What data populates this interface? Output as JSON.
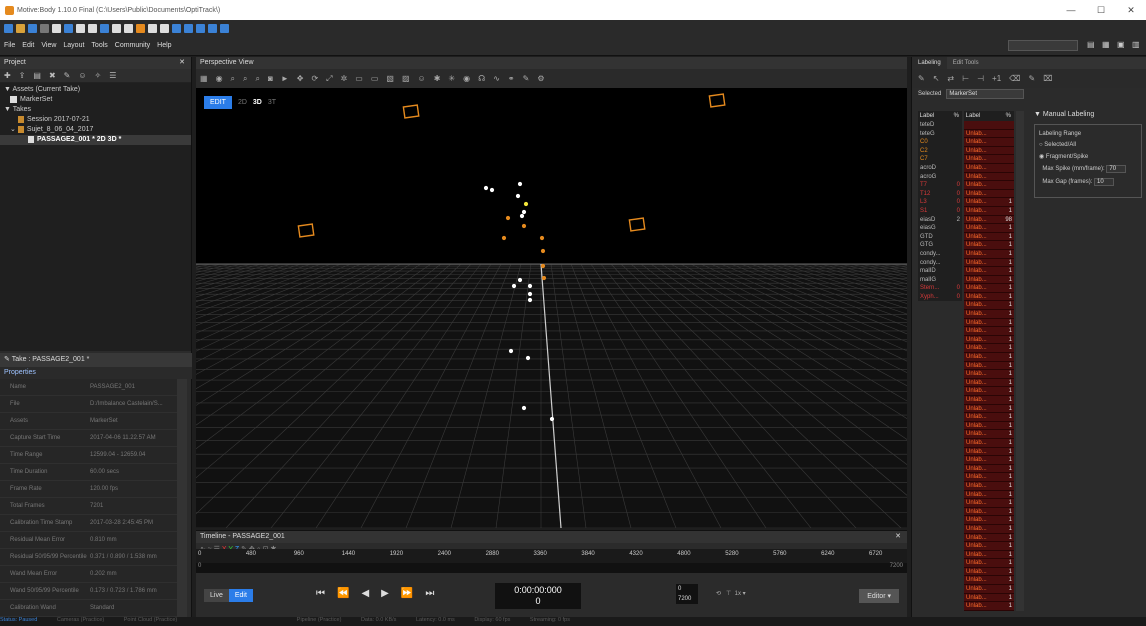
{
  "window": {
    "title": "Motive:Body 1.10.0 Final (C:\\Users\\Public\\Documents\\OptiTrack\\)"
  },
  "menu": [
    "File",
    "Edit",
    "View",
    "Layout",
    "Tools",
    "Community",
    "Help"
  ],
  "project": {
    "header": "Project",
    "tree": [
      {
        "label": "Assets (Current Take)",
        "indent": 0
      },
      {
        "label": "MarkerSet",
        "indent": 1
      },
      {
        "label": "Takes",
        "indent": 0
      },
      {
        "label": "Session 2017-07-21",
        "indent": 1
      },
      {
        "label": "Sujet_8_06_04_2017",
        "indent": 1
      },
      {
        "label": "PASSAGE2_001 *   2D   3D *",
        "indent": 2
      }
    ],
    "take_header": "Take : PASSAGE2_001 *",
    "props_tab": "Properties",
    "properties": [
      {
        "k": "Name",
        "v": "PASSAGE2_001"
      },
      {
        "k": "File",
        "v": "D:/Imbalance Castelain/S..."
      },
      {
        "k": "Assets",
        "v": "MarkerSet"
      },
      {
        "k": "Capture Start Time",
        "v": "2017-04-06 11.22.57 AM"
      },
      {
        "k": "Time Range",
        "v": "12599.04 - 12659.04"
      },
      {
        "k": "Time Duration",
        "v": "60.00 secs"
      },
      {
        "k": "Frame Rate",
        "v": "120.00 fps"
      },
      {
        "k": "Total Frames",
        "v": "7201"
      },
      {
        "k": "Calibration Time Stamp",
        "v": "2017-03-28 2:45:45 PM"
      },
      {
        "k": "Residual Mean Error",
        "v": "0.810 mm"
      },
      {
        "k": "Residual 50/95/99 Percentile",
        "v": "0.371 / 0.890 / 1.538 mm"
      },
      {
        "k": "Wand Mean Error",
        "v": "0.202 mm"
      },
      {
        "k": "Wand 50/95/99 Percentile",
        "v": "0.173 / 0.723 / 1.786 mm"
      },
      {
        "k": "Calibration Wand",
        "v": "Standard"
      },
      {
        "k": "Wand Length",
        "v": "500 mm"
      }
    ]
  },
  "perspective": {
    "header": "Perspective View",
    "modes": {
      "edit": "EDIT",
      "m2d": "2D",
      "m3d": "3D",
      "m3": "3T"
    }
  },
  "timeline": {
    "header": "Timeline - PASSAGE2_001",
    "ticks": [
      "0",
      "480",
      "960",
      "1440",
      "1920",
      "2400",
      "2880",
      "3360",
      "3840",
      "4320",
      "4800",
      "5280",
      "5760",
      "6240",
      "6720"
    ],
    "track_start": "0",
    "track_end": "7200",
    "live": "Live",
    "edit": "Edit",
    "timecode": "0:00:00:000",
    "frame": "0",
    "range_start": "0",
    "range_end": "7200",
    "speed": "1x",
    "editor": "Editor"
  },
  "labeling": {
    "tabs": [
      "Labeling",
      "Edit Tools"
    ],
    "selected_label": "Selected",
    "selected_value": "MarkerSet",
    "col_label": "Label",
    "col_pct": "%",
    "names": [
      {
        "n": "teteD",
        "p": "",
        "c": "#bbbbbb"
      },
      {
        "n": "teteG",
        "p": "",
        "c": "#bbbbbb"
      },
      {
        "n": "C0",
        "p": "",
        "c": "#e58a1e"
      },
      {
        "n": "C2",
        "p": "",
        "c": "#e58a1e"
      },
      {
        "n": "C7",
        "p": "",
        "c": "#e58a1e"
      },
      {
        "n": "acroD",
        "p": "",
        "c": "#bbbbbb"
      },
      {
        "n": "acroG",
        "p": "",
        "c": "#bbbbbb"
      },
      {
        "n": "T7",
        "p": "0",
        "c": "#d83a3a"
      },
      {
        "n": "T12",
        "p": "0",
        "c": "#d83a3a"
      },
      {
        "n": "L3",
        "p": "0",
        "c": "#d83a3a"
      },
      {
        "n": "S1",
        "p": "0",
        "c": "#d83a3a"
      },
      {
        "n": "eiasD",
        "p": "2",
        "c": "#bbbbbb"
      },
      {
        "n": "eiasG",
        "p": "",
        "c": "#bbbbbb"
      },
      {
        "n": "GTD",
        "p": "",
        "c": "#bbbbbb"
      },
      {
        "n": "GTG",
        "p": "",
        "c": "#bbbbbb"
      },
      {
        "n": "condy...",
        "p": "",
        "c": "#bbbbbb"
      },
      {
        "n": "condy...",
        "p": "",
        "c": "#bbbbbb"
      },
      {
        "n": "malID",
        "p": "",
        "c": "#bbbbbb"
      },
      {
        "n": "malIG",
        "p": "",
        "c": "#bbbbbb"
      },
      {
        "n": "Stern...",
        "p": "0",
        "c": "#d83a3a"
      },
      {
        "n": "Xyph...",
        "p": "0",
        "c": "#d83a3a"
      }
    ],
    "unlab_rows": [
      {
        "t": "",
        "p": ""
      },
      {
        "t": "Unlab...",
        "p": ""
      },
      {
        "t": "Unlab...",
        "p": ""
      },
      {
        "t": "Unlab...",
        "p": ""
      },
      {
        "t": "Unlab...",
        "p": ""
      },
      {
        "t": "Unlab...",
        "p": ""
      },
      {
        "t": "Unlab...",
        "p": ""
      },
      {
        "t": "Unlab...",
        "p": ""
      },
      {
        "t": "Unlab...",
        "p": ""
      },
      {
        "t": "Unlab...",
        "p": "1"
      },
      {
        "t": "Unlab...",
        "p": "1"
      },
      {
        "t": "Unlab...",
        "p": "98"
      },
      {
        "t": "Unlab...",
        "p": "1"
      },
      {
        "t": "Unlab...",
        "p": "1"
      },
      {
        "t": "Unlab...",
        "p": "1"
      },
      {
        "t": "Unlab...",
        "p": "1"
      },
      {
        "t": "Unlab...",
        "p": "1"
      },
      {
        "t": "Unlab...",
        "p": "1"
      },
      {
        "t": "Unlab...",
        "p": "1"
      },
      {
        "t": "Unlab...",
        "p": "1"
      },
      {
        "t": "Unlab...",
        "p": "1"
      },
      {
        "t": "Unlab...",
        "p": "1"
      },
      {
        "t": "Unlab...",
        "p": "1"
      },
      {
        "t": "Unlab...",
        "p": "1"
      },
      {
        "t": "Unlab...",
        "p": "1"
      },
      {
        "t": "Unlab...",
        "p": "1"
      },
      {
        "t": "Unlab...",
        "p": "1"
      },
      {
        "t": "Unlab...",
        "p": "1"
      },
      {
        "t": "Unlab...",
        "p": "1"
      },
      {
        "t": "Unlab...",
        "p": "1"
      },
      {
        "t": "Unlab...",
        "p": "1"
      },
      {
        "t": "Unlab...",
        "p": "1"
      },
      {
        "t": "Unlab...",
        "p": "1"
      },
      {
        "t": "Unlab...",
        "p": "1"
      },
      {
        "t": "Unlab...",
        "p": "1"
      },
      {
        "t": "Unlab...",
        "p": "1"
      },
      {
        "t": "Unlab...",
        "p": "1"
      },
      {
        "t": "Unlab...",
        "p": "1"
      },
      {
        "t": "Unlab...",
        "p": "1"
      },
      {
        "t": "Unlab...",
        "p": "1"
      },
      {
        "t": "Unlab...",
        "p": "1"
      },
      {
        "t": "Unlab...",
        "p": "1"
      },
      {
        "t": "Unlab...",
        "p": "1"
      },
      {
        "t": "Unlab...",
        "p": "1"
      },
      {
        "t": "Unlab...",
        "p": "1"
      },
      {
        "t": "Unlab...",
        "p": "1"
      },
      {
        "t": "Unlab...",
        "p": "1"
      },
      {
        "t": "Unlab...",
        "p": "1"
      },
      {
        "t": "Unlab...",
        "p": "1"
      },
      {
        "t": "Unlab...",
        "p": "1"
      },
      {
        "t": "Unlab...",
        "p": "1"
      },
      {
        "t": "Unlab...",
        "p": "1"
      },
      {
        "t": "Unlab...",
        "p": "1"
      },
      {
        "t": "Unlab...",
        "p": "1"
      },
      {
        "t": "Unlab...",
        "p": "1"
      },
      {
        "t": "Unlab...",
        "p": "1"
      },
      {
        "t": "Unlab...",
        "p": "1"
      }
    ],
    "manual": {
      "title": "Manual Labeling",
      "range_title": "Labeling Range",
      "opt1": "Selected/All",
      "opt2": "Fragment/Spike",
      "spike_label": "Max Spike (mm/frame):",
      "spike_value": "70",
      "gap_label": "Max Gap (frames):",
      "gap_value": "10"
    }
  },
  "status": [
    "Status: Paused",
    "Cameras (Practice)",
    "Point Cloud (Practice)",
    "Pipeline (Practice)",
    "Data: 0.0 KB/s",
    "Latency: 0.0 ms",
    "Display: 60 fps",
    "Streaming: 0 fps"
  ],
  "colors": {
    "accent": "#2b7de9",
    "marker_orange": "#e58a1e",
    "marker_yellow": "#f2e53a"
  }
}
